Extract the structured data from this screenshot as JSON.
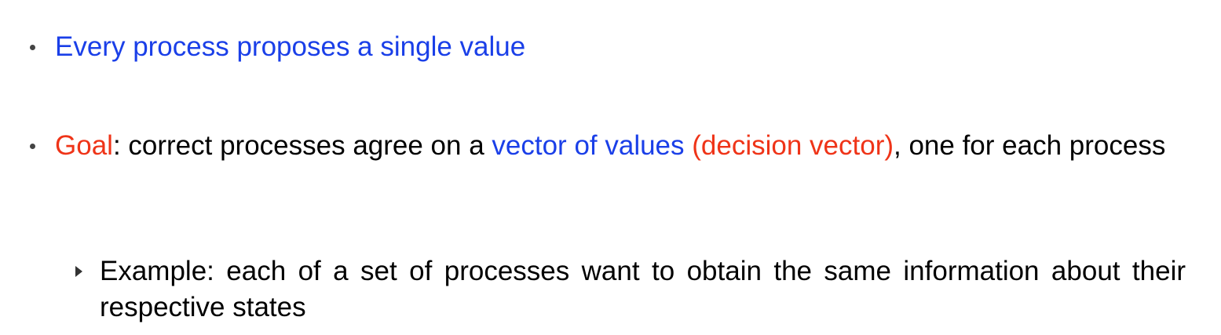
{
  "colors": {
    "text": "#000000",
    "blue": "#1a3fe8",
    "red": "#ef3418"
  },
  "bullets": [
    {
      "level": 1,
      "marker": "bullet-dot",
      "text": "Every process proposes a single value"
    },
    {
      "level": 1,
      "marker": "bullet-dot",
      "goal": "Goal",
      "t1": ": correct processes agree on a ",
      "vector": "vector of values ",
      "decision": "(decision vector)",
      "t2": ", one for each process"
    },
    {
      "level": 2,
      "marker": "bullet-triangle",
      "text": "Example: each of a set of processes want to obtain the same information about their respective states"
    }
  ]
}
